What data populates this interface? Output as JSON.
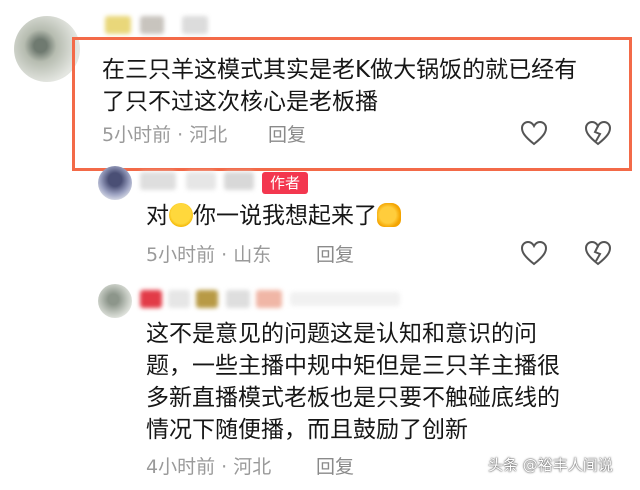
{
  "comments": [
    {
      "lines": [
        "在三只羊这模式其实是老K做大锅饭的就已经有",
        "了只不过这次核心是老板播"
      ],
      "time": "5小时前",
      "dot": "·",
      "location": "河北",
      "reply": "回复"
    },
    {
      "author_tag": "作者",
      "text_before": "对",
      "text_after": "你一说我想起来了",
      "time": "5小时前",
      "dot": "·",
      "location": "山东",
      "reply": "回复"
    },
    {
      "lines": [
        "这不是意见的问题这是认知和意识的问",
        "题，一些主播中规中矩但是三只羊主播很",
        "多新直播模式老板也是只要不触碰底线的",
        "情况下随便播，而且鼓励了创新"
      ],
      "time": "4小时前",
      "dot": "·",
      "location": "河北",
      "reply": "回复"
    }
  ],
  "watermark": "头条 @裕丰人间说",
  "colors": {
    "highlight_border": "#f36a48",
    "author_tag": "#f3374f"
  }
}
